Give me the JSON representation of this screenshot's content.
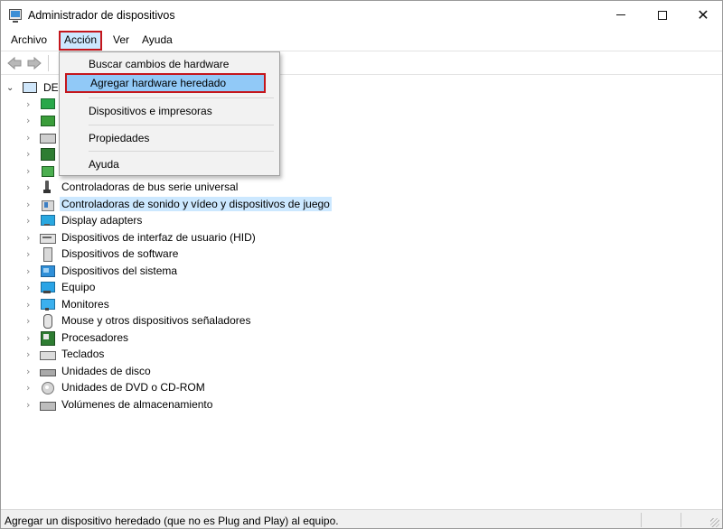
{
  "window": {
    "title": "Administrador de dispositivos"
  },
  "menubar": {
    "items": [
      "Archivo",
      "Acción",
      "Ver",
      "Ayuda"
    ]
  },
  "action_menu": {
    "items": [
      "Buscar cambios de hardware",
      "Agregar hardware heredado",
      "Dispositivos e impresoras",
      "Propiedades",
      "Ayuda"
    ],
    "highlighted": "Agregar hardware heredado"
  },
  "tree": {
    "root_label": "DE",
    "categories": [
      {
        "label": "Controladoras de bus serie universal",
        "icon": "usb-icon"
      },
      {
        "label": "Controladoras de sonido y vídeo y dispositivos de juego",
        "icon": "sound-device-icon",
        "selected": true
      },
      {
        "label": "Display adapters",
        "icon": "display-adapter-icon"
      },
      {
        "label": "Dispositivos de interfaz de usuario (HID)",
        "icon": "hid-icon"
      },
      {
        "label": "Dispositivos de software",
        "icon": "software-device-icon"
      },
      {
        "label": "Dispositivos del sistema",
        "icon": "system-device-icon"
      },
      {
        "label": "Equipo",
        "icon": "computer-icon"
      },
      {
        "label": "Monitores",
        "icon": "monitor-icon"
      },
      {
        "label": "Mouse y otros dispositivos señaladores",
        "icon": "mouse-icon"
      },
      {
        "label": "Procesadores",
        "icon": "processor-icon"
      },
      {
        "label": "Teclados",
        "icon": "keyboard-icon"
      },
      {
        "label": "Unidades de disco",
        "icon": "disk-drive-icon"
      },
      {
        "label": "Unidades de DVD o CD-ROM",
        "icon": "dvd-drive-icon"
      },
      {
        "label": "Volúmenes de almacenamiento",
        "icon": "storage-volume-icon"
      }
    ]
  },
  "statusbar": {
    "text": "Agregar un dispositivo heredado (que no es Plug and Play) al equipo."
  },
  "colors": {
    "accent_highlight": "#cce8ff",
    "menu_hover": "#91c9f7",
    "annotation_red": "#c4161c"
  }
}
